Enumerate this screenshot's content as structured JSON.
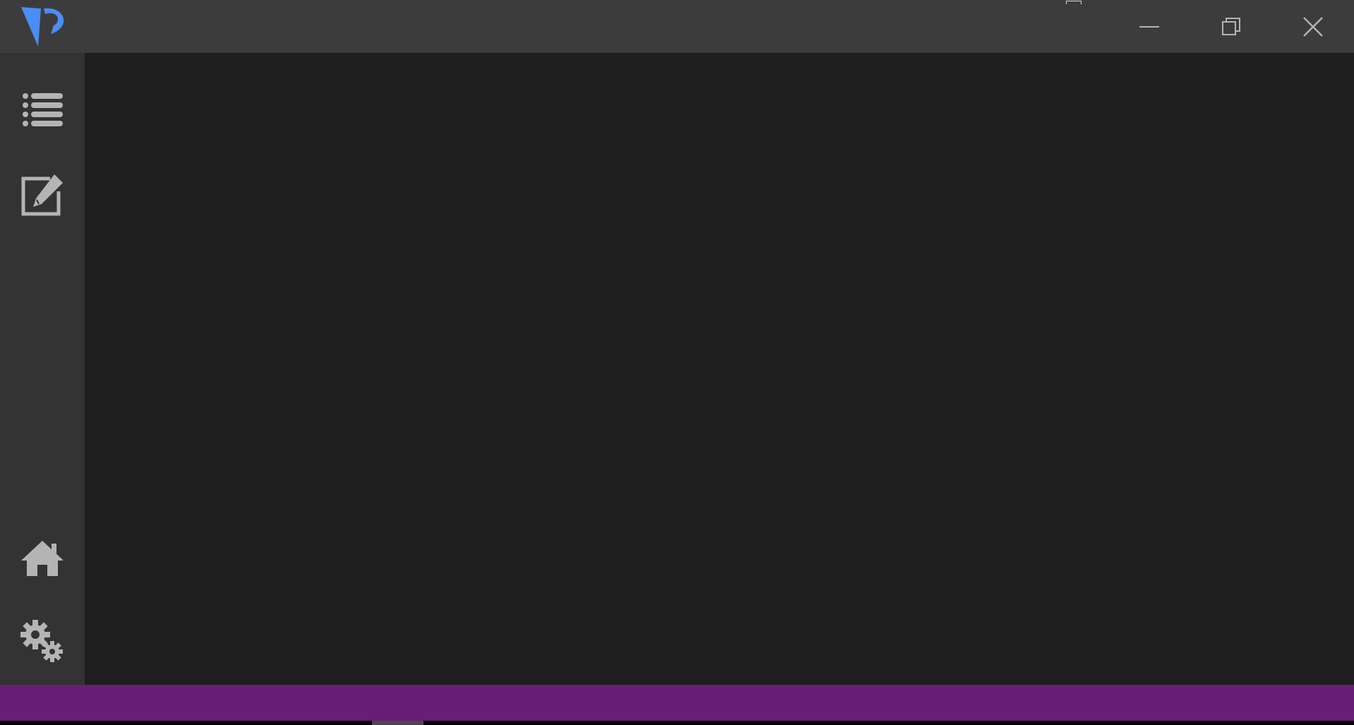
{
  "colors": {
    "titlebar": "#3c3c3c",
    "sidebar": "#333333",
    "content": "#1e1e1e",
    "statusbar": "#671e75",
    "taskbar": "#000000",
    "taskbar_tab": "#4a4a4a",
    "icon": "#b4b4b4",
    "logo": "#4a8df6"
  },
  "titlebar": {
    "logo_icon": "app-logo-icon",
    "controls": {
      "minimize_icon": "minimize-icon",
      "restore_icon": "restore-icon",
      "close_icon": "close-icon"
    }
  },
  "sidebar": {
    "top_items": [
      {
        "icon": "list-icon"
      },
      {
        "icon": "edit-icon"
      }
    ],
    "bottom_items": [
      {
        "icon": "home-icon"
      },
      {
        "icon": "settings-icon"
      }
    ]
  }
}
